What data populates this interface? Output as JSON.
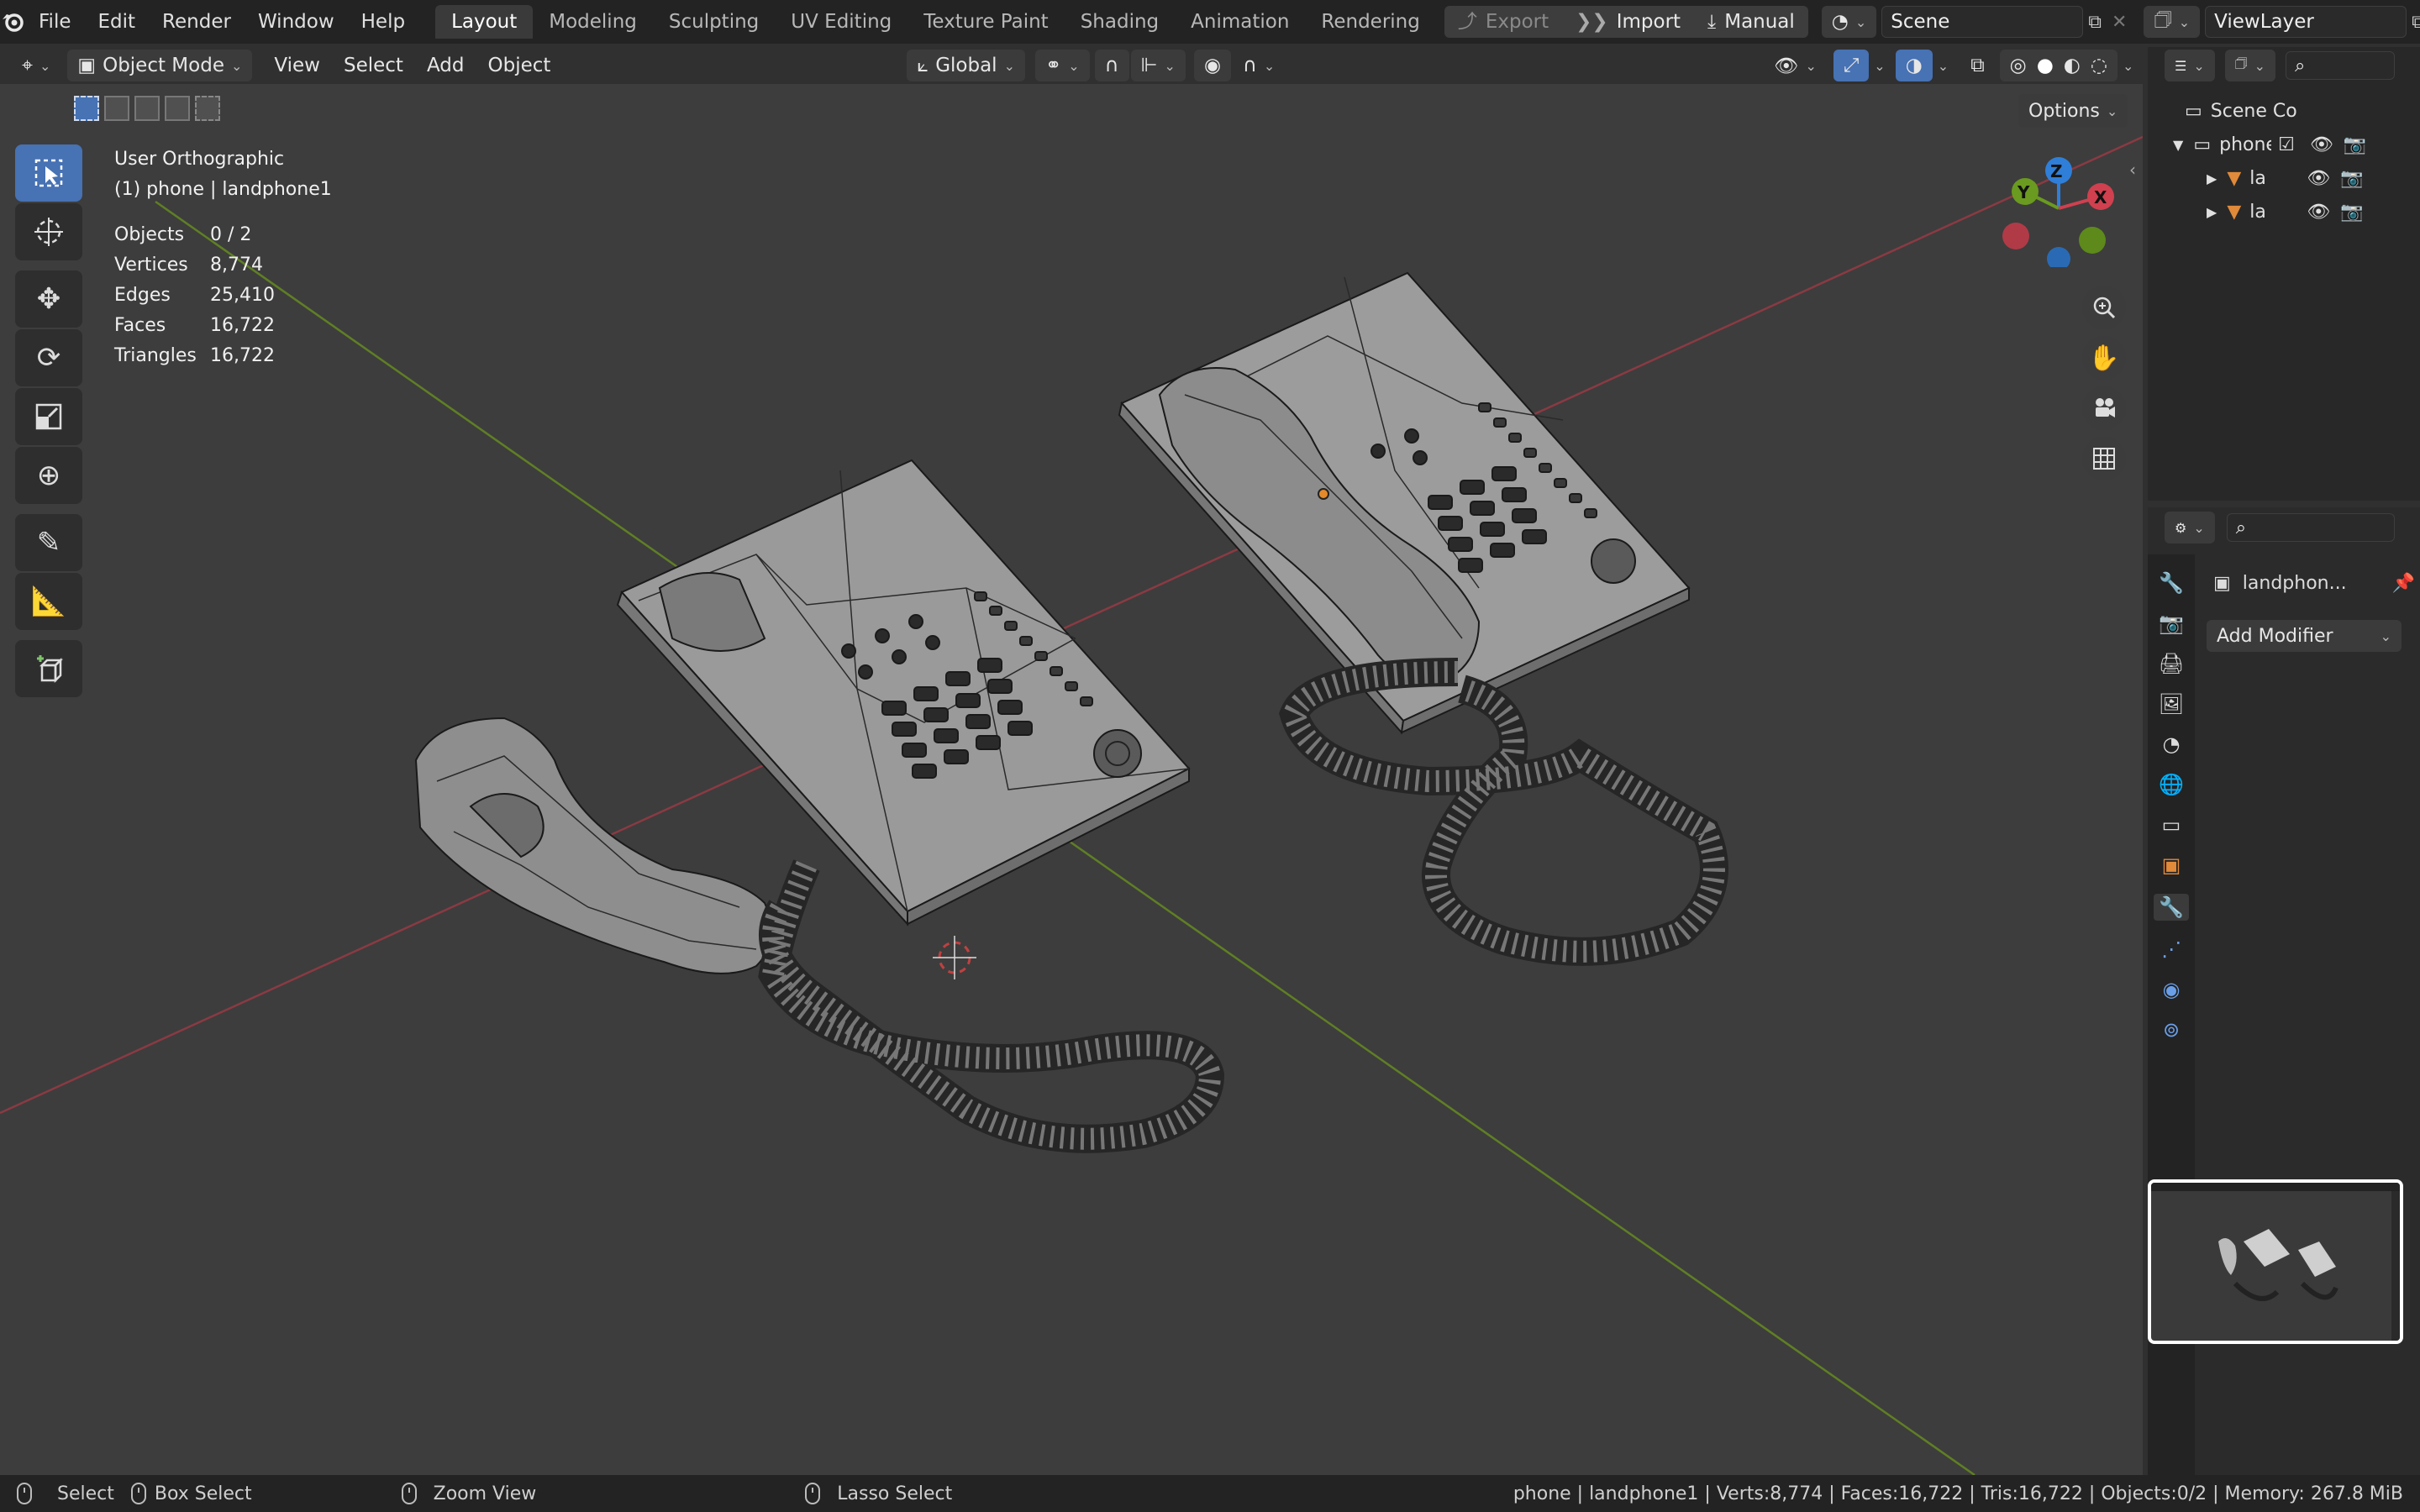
{
  "menus": [
    "File",
    "Edit",
    "Render",
    "Window",
    "Help"
  ],
  "workspace_tabs": [
    {
      "label": "Layout",
      "active": true
    },
    {
      "label": "Modeling"
    },
    {
      "label": "Sculpting"
    },
    {
      "label": "UV Editing"
    },
    {
      "label": "Texture Paint"
    },
    {
      "label": "Shading"
    },
    {
      "label": "Animation"
    },
    {
      "label": "Rendering"
    }
  ],
  "top_buttons": {
    "export": "Export",
    "import": "Import",
    "manual": "Manual"
  },
  "scene_name": "Scene",
  "view_layer": "ViewLayer",
  "viewport_header": {
    "mode": "Object Mode",
    "menus": [
      "View",
      "Select",
      "Add",
      "Object"
    ],
    "orientation": "Global",
    "options_label": "Options"
  },
  "overlay": {
    "view_name": "User Orthographic",
    "context": "(1) phone | landphone1",
    "stats": [
      {
        "key": "Objects",
        "value": "0 / 2"
      },
      {
        "key": "Vertices",
        "value": "8,774"
      },
      {
        "key": "Edges",
        "value": "25,410"
      },
      {
        "key": "Faces",
        "value": "16,722"
      },
      {
        "key": "Triangles",
        "value": "16,722"
      }
    ]
  },
  "gizmo": {
    "x": "X",
    "y": "Y",
    "z": "Z"
  },
  "outliner": {
    "root": "Scene Co",
    "collection": "phone",
    "items": [
      "la",
      "la"
    ]
  },
  "properties": {
    "object_name": "landphon...",
    "add_modifier": "Add Modifier"
  },
  "statusbar": {
    "select": "Select",
    "box_select": "Box Select",
    "zoom_view": "Zoom View",
    "lasso_select": "Lasso Select",
    "info": "phone | landphone1 | Verts:8,774 | Faces:16,722 | Tris:16,722 | Objects:0/2 | Memory: 267.8 MiB"
  },
  "colors": {
    "accent": "#4772b3",
    "x_axis": "#d0404f",
    "y_axis": "#6a9a1f",
    "z_axis": "#2f7fd8",
    "viewport_bg": "#3d3d3d"
  }
}
